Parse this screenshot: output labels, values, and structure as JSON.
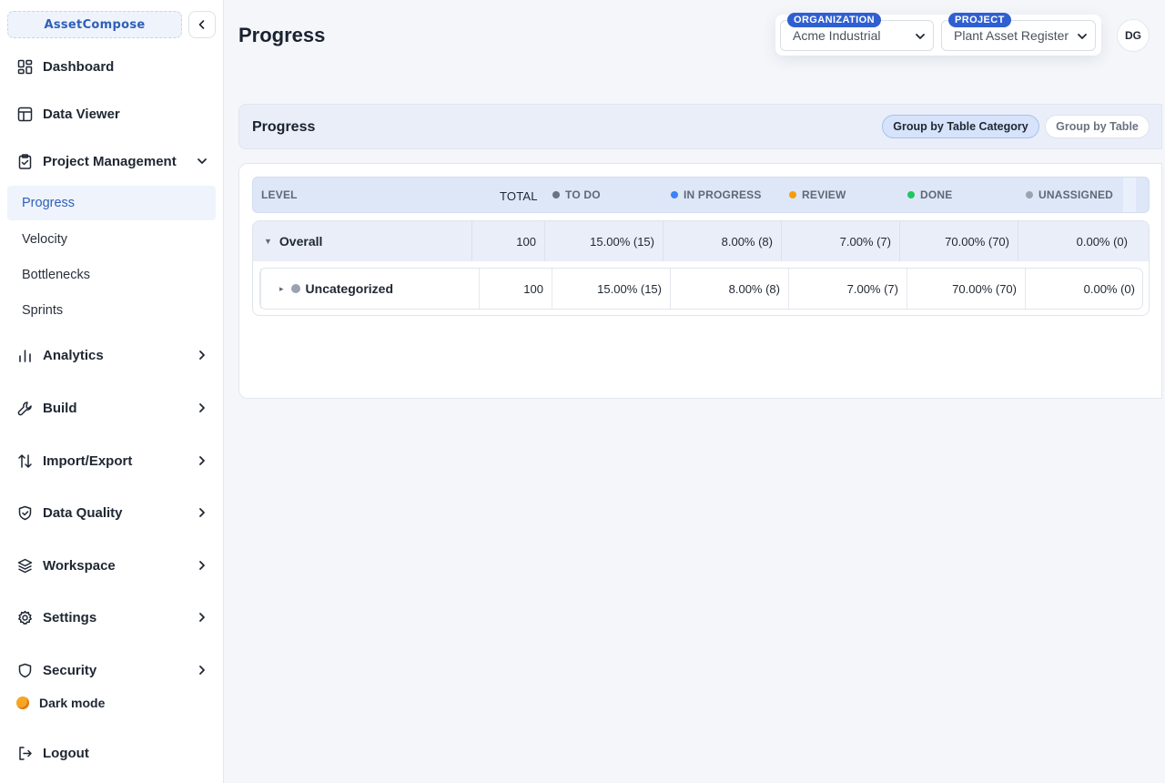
{
  "brand": "AssetCompose",
  "sidebar": {
    "items": [
      {
        "label": "Dashboard"
      },
      {
        "label": "Data Viewer"
      },
      {
        "label": "Project Management"
      },
      {
        "label": "Analytics"
      },
      {
        "label": "Build"
      },
      {
        "label": "Import/Export"
      },
      {
        "label": "Data Quality"
      },
      {
        "label": "Workspace"
      },
      {
        "label": "Settings"
      },
      {
        "label": "Security"
      }
    ],
    "sub_items": [
      {
        "label": "Progress",
        "active": true
      },
      {
        "label": "Velocity"
      },
      {
        "label": "Bottlenecks"
      },
      {
        "label": "Sprints"
      }
    ],
    "dark_mode": "Dark mode",
    "logout": "Logout"
  },
  "header": {
    "title": "Progress",
    "organization_tag": "ORGANIZATION",
    "organization_value": "Acme Industrial",
    "project_tag": "PROJECT",
    "project_value": "Plant Asset Register",
    "avatar": "DG"
  },
  "section": {
    "title": "Progress",
    "group_by_category": "Group by Table Category",
    "group_by_table": "Group by Table"
  },
  "table": {
    "headers": {
      "level": "LEVEL",
      "total": "TOTAL",
      "todo": "TO DO",
      "in_progress": "IN PROGRESS",
      "review": "REVIEW",
      "done": "DONE",
      "unassigned": "UNASSIGNED"
    },
    "rows": [
      {
        "label": "Overall",
        "total": "100",
        "todo": "15.00% (15)",
        "in_progress": "8.00% (8)",
        "review": "7.00% (7)",
        "done": "70.00% (70)",
        "unassigned": "0.00% (0)"
      },
      {
        "label": "Uncategorized",
        "total": "100",
        "todo": "15.00% (15)",
        "in_progress": "8.00% (8)",
        "review": "7.00% (7)",
        "done": "70.00% (70)",
        "unassigned": "0.00% (0)"
      }
    ]
  },
  "colors": {
    "accent": "#2f5fd0",
    "todo": "#6b7280",
    "in_progress": "#3b82f6",
    "review": "#f59e0b",
    "done": "#22c55e",
    "unassigned": "#9ca3af"
  }
}
